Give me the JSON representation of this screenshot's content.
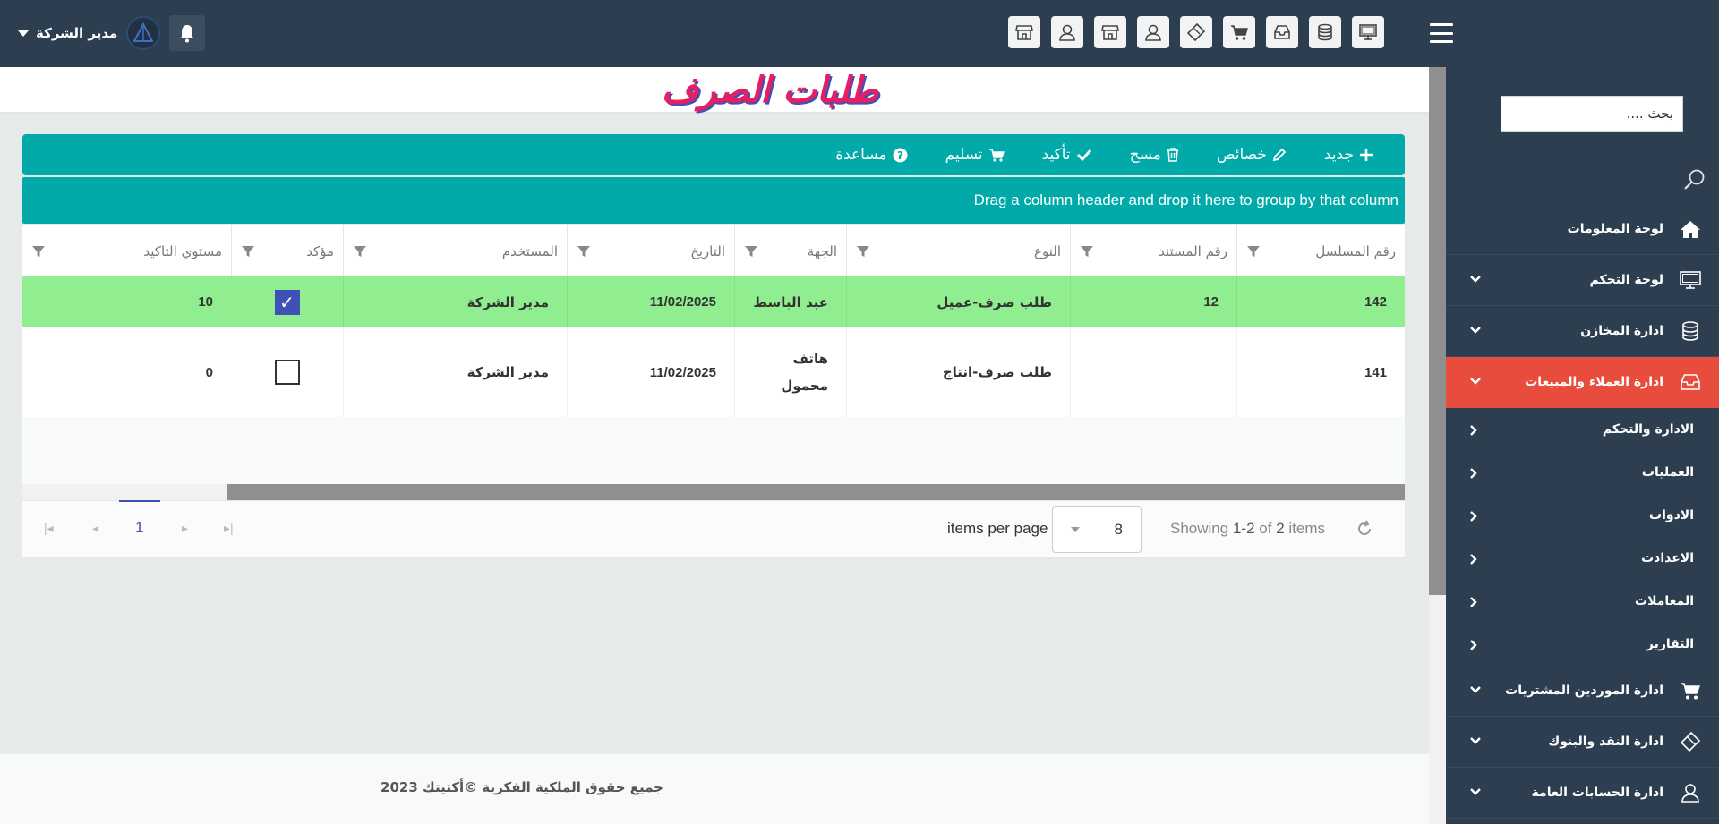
{
  "topbar": {
    "user_name": "مدير الشركة",
    "quick_icons": [
      "monitor-icon",
      "database-icon",
      "inbox-icon",
      "cart-icon",
      "ticket-icon",
      "user-icon",
      "store-icon",
      "user-icon",
      "store-icon"
    ]
  },
  "page": {
    "title": "طلبات الصرف"
  },
  "toolbar": {
    "new_label": "جديد",
    "properties_label": "خصائص",
    "delete_label": "مسح",
    "confirm_label": "تأكيد",
    "deliver_label": "تسليم",
    "help_label": "مساعدة"
  },
  "grid": {
    "group_hint": "Drag a column header and drop it here to group by that column",
    "columns": [
      "رقم المسلسل",
      "رقم المستند",
      "النوع",
      "الجهة",
      "التاريخ",
      "المستخدم",
      "مؤكد",
      "مستوي التاكيد"
    ],
    "rows": [
      {
        "serial": "142",
        "doc_no": "12",
        "type": "طلب صرف-عميل",
        "party": "عبد الباسط",
        "date": "11/02/2025",
        "user": "مدير الشركة",
        "confirmed": true,
        "level": "10"
      },
      {
        "serial": "141",
        "doc_no": "",
        "type": "طلب صرف-انتاج",
        "party": "هاتف محمول",
        "date": "11/02/2025",
        "user": "مدير الشركة",
        "confirmed": false,
        "level": "0"
      }
    ]
  },
  "pager": {
    "current_page": "1",
    "items_per_page_label": "items per page",
    "items_per_page": "8",
    "showing_prefix": "Showing",
    "showing_range": "1-2",
    "showing_of": "of",
    "showing_total": "2",
    "showing_suffix": "items"
  },
  "footer": {
    "text": "جميع حقوق الملكية الفكرية ©أكتيتك 2023"
  },
  "sidebar": {
    "search_placeholder": "بحث ....",
    "items": [
      {
        "label": "لوحة المعلومات",
        "icon": "home-icon"
      },
      {
        "label": "لوحة التحكم",
        "icon": "monitor-icon"
      },
      {
        "label": "ادارة المخازن",
        "icon": "database-icon"
      },
      {
        "label": "ادارة العملاء والمبيعات",
        "icon": "inbox-icon"
      },
      {
        "label": "ادارة الموردين المشتريات",
        "icon": "cart-icon"
      },
      {
        "label": "ادارة النقد والبنوك",
        "icon": "ticket-icon"
      },
      {
        "label": "ادارة الحسابات العامة",
        "icon": "user-icon"
      }
    ],
    "subitems": [
      "الادارة والتحكم",
      "العمليات",
      "الادوات",
      "الاعدادت",
      "المعاملات",
      "التقارير"
    ]
  },
  "colors": {
    "topbar": "#2c3e50",
    "accent": "#01aaa9",
    "active": "#e74c3c",
    "row_highlight": "#90ee90",
    "title": "#e81e63"
  }
}
